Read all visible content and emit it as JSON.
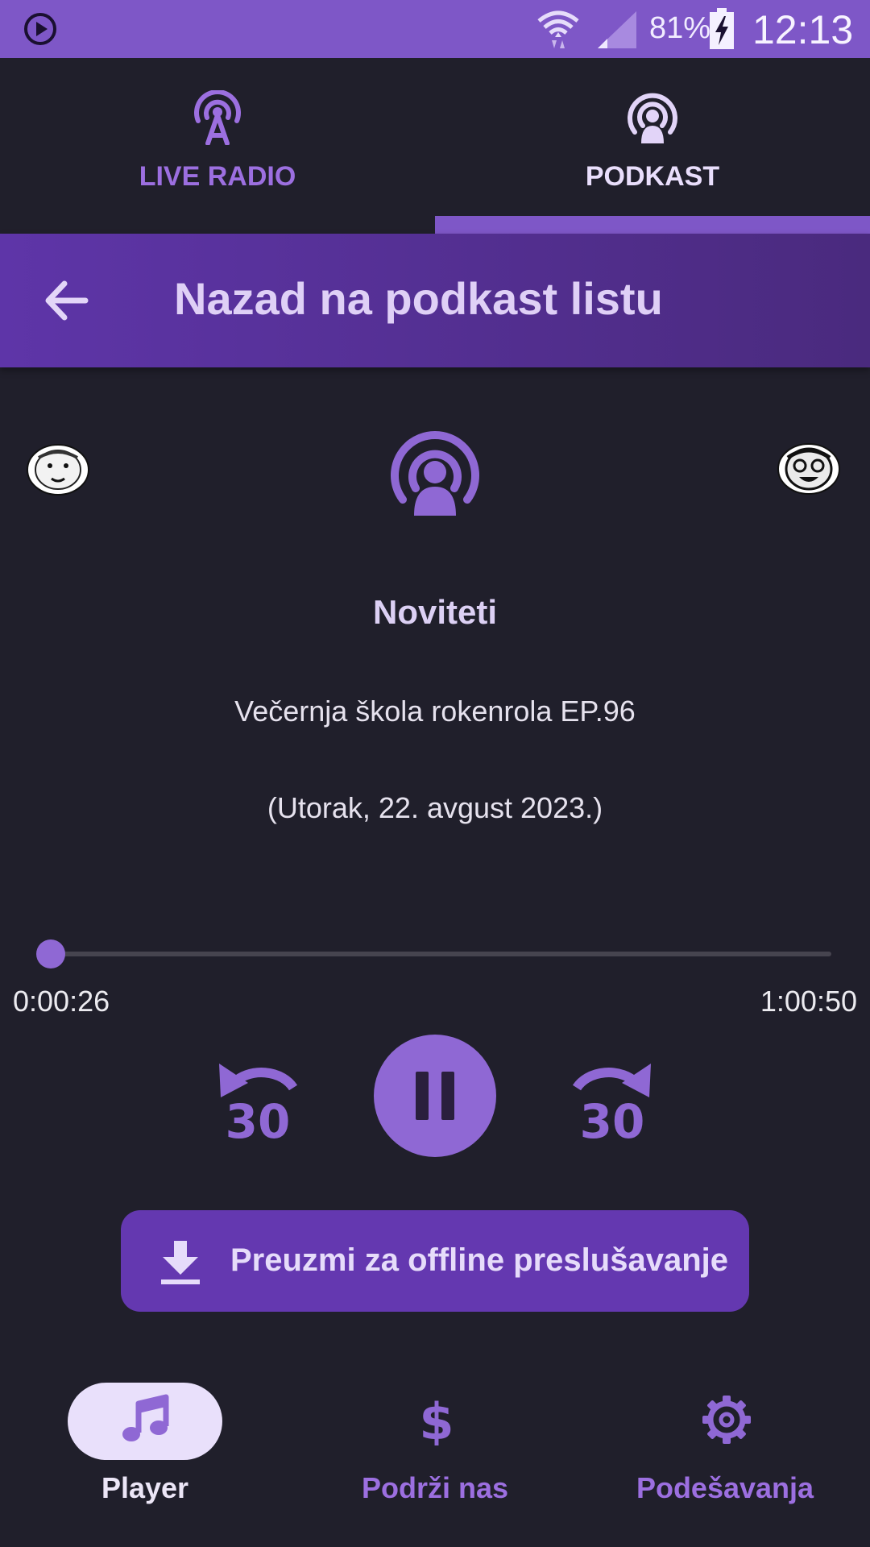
{
  "status_bar": {
    "battery_percent": "81%",
    "time": "12:13",
    "icons": [
      "media-play-indicator-icon",
      "wifi-icon",
      "cell-signal-icon",
      "battery-charging-icon"
    ]
  },
  "tabs": [
    {
      "label": "LIVE RADIO",
      "icon": "radio-tower-icon",
      "selected": false
    },
    {
      "label": "PODKAST",
      "icon": "podcast-icon",
      "selected": true
    }
  ],
  "header": {
    "title": "Nazad na podkast listu",
    "back_icon": "arrow-back-icon"
  },
  "episode": {
    "show": "Noviteti",
    "title": "Večernja škola rokenrola EP.96",
    "date": "(Utorak, 22. avgust 2023.)"
  },
  "player": {
    "elapsed": "0:00:26",
    "total": "1:00:50",
    "progress_fraction": 0.007,
    "rewind_seconds": "30",
    "forward_seconds": "30",
    "state": "playing"
  },
  "download": {
    "label": "Preuzmi za offline preslušavanje",
    "icon": "download-icon"
  },
  "bottom_nav": [
    {
      "label": "Player",
      "icon": "music-note-icon",
      "selected": true
    },
    {
      "label": "Podrži nas",
      "icon": "dollar-icon",
      "selected": false
    },
    {
      "label": "Podešavanja",
      "icon": "gear-icon",
      "selected": false
    }
  ],
  "colors": {
    "accent": "#7e57c7",
    "background": "#201f2b",
    "header": "#5e35a8",
    "button": "#6438b0",
    "selected_nav_pill": "#e9e0fb"
  }
}
